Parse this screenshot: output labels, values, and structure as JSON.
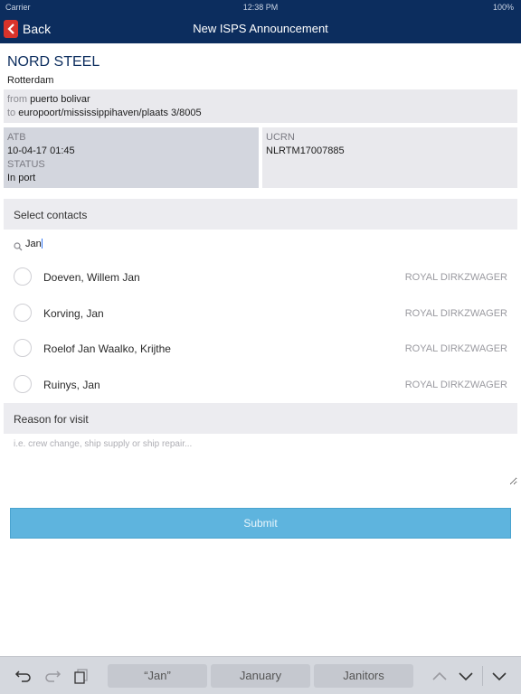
{
  "status_bar": {
    "carrier": "Carrier",
    "time": "12:38 PM",
    "battery": "100%"
  },
  "nav": {
    "back_label": "Back",
    "title": "New ISPS Announcement"
  },
  "ship": {
    "name": "NORD STEEL",
    "port": "Rotterdam",
    "route": {
      "from_label": "from",
      "from_value": "puerto bolivar",
      "to_label": "to",
      "to_value": "europoort/mississippihaven/plaats 3/8005"
    },
    "atb_label": "ATB",
    "atb_value": "10-04-17 01:45",
    "status_label": "STATUS",
    "status_value": "In port",
    "ucrn_label": "UCRN",
    "ucrn_value": "NLRTM17007885"
  },
  "contacts_section": {
    "title": "Select contacts",
    "search_value": "Jan",
    "items": [
      {
        "name": "Doeven, Willem Jan",
        "org": "ROYAL DIRKZWAGER"
      },
      {
        "name": "Korving, Jan",
        "org": "ROYAL DIRKZWAGER"
      },
      {
        "name": "Roelof Jan Waalko, Krijthe",
        "org": "ROYAL DIRKZWAGER"
      },
      {
        "name": "Ruinys, Jan",
        "org": "ROYAL DIRKZWAGER"
      }
    ]
  },
  "reason_section": {
    "title": "Reason for visit",
    "placeholder": "i.e. crew change, ship supply or ship repair..."
  },
  "submit_label": "Submit",
  "keyboard": {
    "suggestions": [
      "“Jan”",
      "January",
      "Janitors"
    ],
    "icons": [
      "undo-icon",
      "redo-icon",
      "paste-icon",
      "chevron-up-icon",
      "chevron-down-icon",
      "dismiss-keyboard-icon"
    ]
  },
  "colors": {
    "nav_bg": "#0c2d5e",
    "back_badge": "#d9332b",
    "submit_bg": "#5eb4de",
    "title_text": "#0c2d5e"
  }
}
